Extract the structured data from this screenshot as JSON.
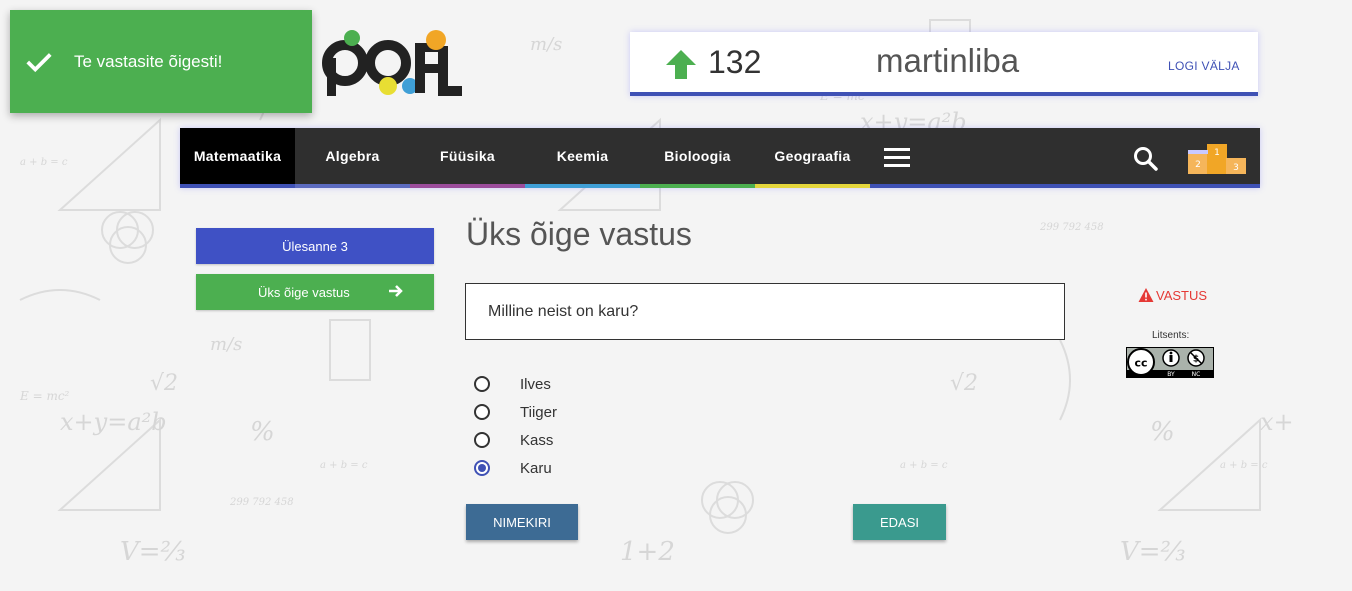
{
  "toast": {
    "message": "Te vastasite õigesti!"
  },
  "user": {
    "score": "132",
    "username": "martinliba",
    "logout_label": "LOGI VÄLJA"
  },
  "nav": {
    "items": [
      {
        "label": "Matemaatika",
        "color": "#3f51b5",
        "active": true
      },
      {
        "label": "Algebra",
        "color": "#5c6bc0"
      },
      {
        "label": "Füüsika",
        "color": "#9c4d9c"
      },
      {
        "label": "Keemia",
        "color": "#3f9fd6"
      },
      {
        "label": "Bioloogia",
        "color": "#4caf50"
      },
      {
        "label": "Geograafia",
        "color": "#e3d53b"
      }
    ],
    "podium_numbers": [
      "1",
      "2",
      "3"
    ]
  },
  "sidebar": {
    "task_label": "Ülesanne 3",
    "type_label": "Üks õige vastus"
  },
  "main": {
    "title": "Üks õige vastus",
    "question": "Milline neist on karu?",
    "options": [
      {
        "label": "Ilves",
        "selected": false
      },
      {
        "label": "Tiiger",
        "selected": false
      },
      {
        "label": "Kass",
        "selected": false
      },
      {
        "label": "Karu",
        "selected": true
      }
    ],
    "list_button": "NIMEKIRI",
    "next_button": "EDASI"
  },
  "side": {
    "answer_label": "VASTUS",
    "license_label": "Litsents:",
    "cc_by": "BY",
    "cc_nc": "NC"
  },
  "colors": {
    "accent": "#3f51b5",
    "success": "#4caf50",
    "danger": "#e53935"
  }
}
